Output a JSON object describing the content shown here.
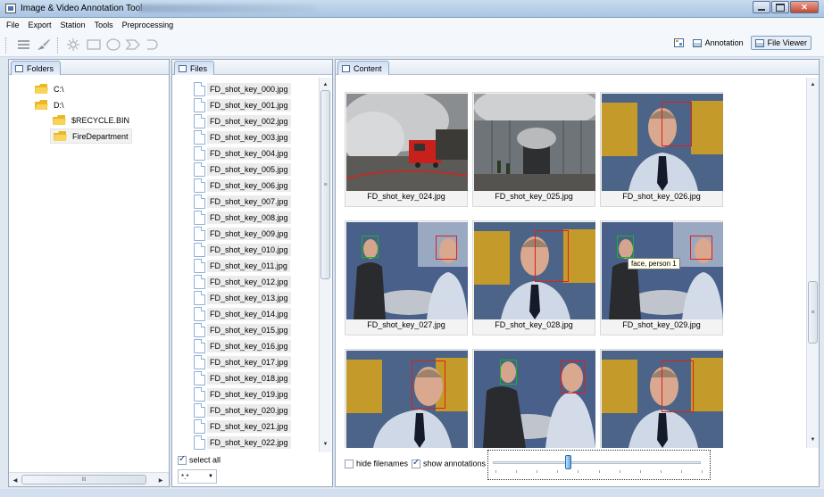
{
  "window": {
    "title": "Image & Video Annotation Tool"
  },
  "menu": [
    "File",
    "Export",
    "Station",
    "Tools",
    "Preprocessing"
  ],
  "toolbar": {
    "icons": [
      "list-view-icon",
      "brush-icon",
      "settings-burst-icon",
      "rectangle-tool-icon",
      "ellipse-tool-icon",
      "chevron-tool-icon",
      "arc-tool-icon"
    ]
  },
  "perspectives": {
    "annotation_label": "Annotation",
    "file_viewer_label": "File Viewer",
    "active": "File Viewer"
  },
  "folders": {
    "tab_label": "Folders",
    "items": [
      {
        "label": "C:\\",
        "depth": 0,
        "expanded": false
      },
      {
        "label": "D:\\",
        "depth": 0,
        "expanded": true
      },
      {
        "label": "$RECYCLE.BIN",
        "depth": 1
      },
      {
        "label": "FireDepartment",
        "depth": 1,
        "selected": true
      }
    ],
    "hscroll_label": "III"
  },
  "files": {
    "tab_label": "Files",
    "items": [
      "FD_shot_key_000.jpg",
      "FD_shot_key_001.jpg",
      "FD_shot_key_002.jpg",
      "FD_shot_key_003.jpg",
      "FD_shot_key_004.jpg",
      "FD_shot_key_005.jpg",
      "FD_shot_key_006.jpg",
      "FD_shot_key_007.jpg",
      "FD_shot_key_008.jpg",
      "FD_shot_key_009.jpg",
      "FD_shot_key_010.jpg",
      "FD_shot_key_011.jpg",
      "FD_shot_key_012.jpg",
      "FD_shot_key_013.jpg",
      "FD_shot_key_014.jpg",
      "FD_shot_key_015.jpg",
      "FD_shot_key_016.jpg",
      "FD_shot_key_017.jpg",
      "FD_shot_key_018.jpg",
      "FD_shot_key_019.jpg",
      "FD_shot_key_020.jpg",
      "FD_shot_key_021.jpg",
      "FD_shot_key_022.jpg"
    ],
    "select_all_label": "select all",
    "select_all_checked": true,
    "filter_value": "*.*"
  },
  "content": {
    "tab_label": "Content",
    "thumbnails": [
      {
        "caption": "FD_shot_key_024.jpg",
        "scene": "fire-truck"
      },
      {
        "caption": "FD_shot_key_025.jpg",
        "scene": "burning-hall"
      },
      {
        "caption": "FD_shot_key_026.jpg",
        "scene": "closeup"
      },
      {
        "caption": "FD_shot_key_027.jpg",
        "scene": "interview"
      },
      {
        "caption": "FD_shot_key_028.jpg",
        "scene": "closeup"
      },
      {
        "caption": "FD_shot_key_029.jpg",
        "scene": "interview"
      },
      {
        "caption": "",
        "scene": "closeup"
      },
      {
        "caption": "",
        "scene": "interview"
      },
      {
        "caption": "",
        "scene": "closeup"
      }
    ],
    "tooltip": "face, person 1",
    "hide_filenames_label": "hide filenames",
    "hide_filenames_checked": false,
    "show_annotations_label": "show annotations",
    "show_annotations_checked": true,
    "zoom_slider_value": 0.35
  },
  "colors": {
    "annotation_primary": "#e0201a",
    "annotation_secondary": "#14b81f",
    "accent": "#4a6b95"
  }
}
